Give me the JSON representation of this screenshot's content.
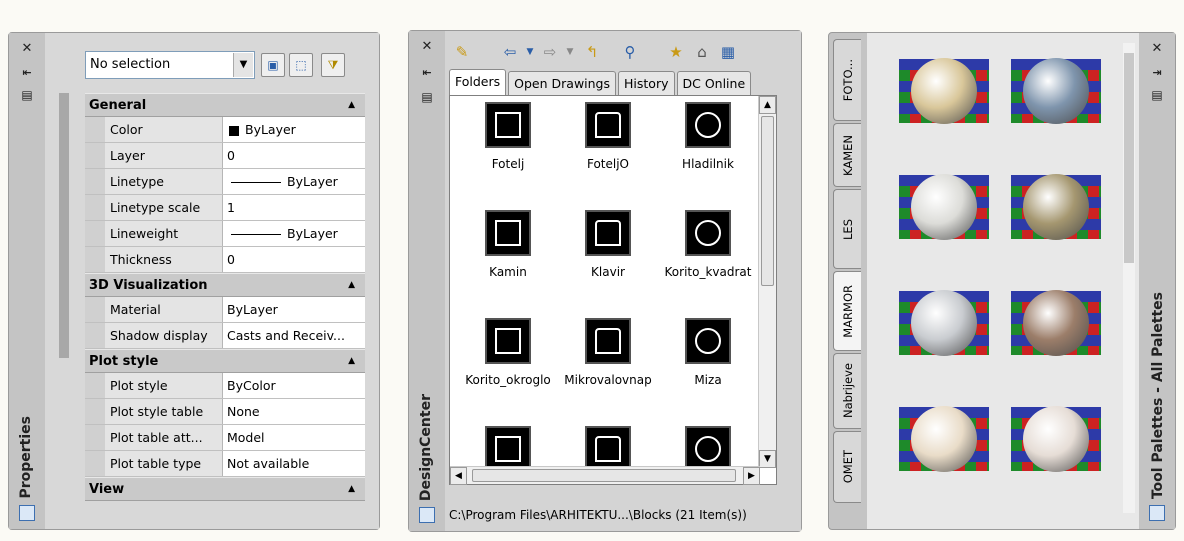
{
  "properties": {
    "title": "Properties",
    "selection": "No selection",
    "categories": [
      {
        "name": "General",
        "rows": [
          {
            "key": "Color",
            "value": "ByLayer",
            "swatch": true
          },
          {
            "key": "Layer",
            "value": "0"
          },
          {
            "key": "Linetype",
            "value": "ByLayer",
            "line": true
          },
          {
            "key": "Linetype scale",
            "value": "1"
          },
          {
            "key": "Lineweight",
            "value": "ByLayer",
            "line": true
          },
          {
            "key": "Thickness",
            "value": "0"
          }
        ]
      },
      {
        "name": "3D Visualization",
        "rows": [
          {
            "key": "Material",
            "value": "ByLayer"
          },
          {
            "key": "Shadow display",
            "value": "Casts and Receiv..."
          }
        ]
      },
      {
        "name": "Plot style",
        "rows": [
          {
            "key": "Plot style",
            "value": "ByColor"
          },
          {
            "key": "Plot style table",
            "value": "None"
          },
          {
            "key": "Plot table att...",
            "value": "Model"
          },
          {
            "key": "Plot table type",
            "value": "Not available"
          }
        ]
      },
      {
        "name": "View",
        "rows": []
      }
    ]
  },
  "designcenter": {
    "title": "DesignCenter",
    "tabs": [
      "Folders",
      "Open Drawings",
      "History",
      "DC Online"
    ],
    "active_tab": "Folders",
    "blocks": [
      "Fotelj",
      "FoteljO",
      "Hladilnik",
      "Kamin",
      "Klavir",
      "Korito_kvadrat",
      "Korito_okroglo",
      "Mikrovalovnap",
      "Miza",
      "",
      "",
      ""
    ],
    "status": "C:\\Program Files\\ARHITEKTU...\\Blocks (21 Item(s))"
  },
  "toolpalettes": {
    "title": "Tool Palettes - All Palettes",
    "tabs": [
      "FOTO...",
      "KAMEN",
      "LES",
      "MARMOR",
      "Nabrijeve",
      "OMET"
    ],
    "active_tab": "MARMOR",
    "materials": [
      {
        "color": "#d9c79a"
      },
      {
        "color": "#7f95ad"
      },
      {
        "color": "#dcdcd8"
      },
      {
        "color": "#a59770"
      },
      {
        "color": "#c9ccd0"
      },
      {
        "color": "#9c7e6a"
      },
      {
        "color": "#e9dcc8"
      },
      {
        "color": "#e6ddd6"
      }
    ]
  }
}
